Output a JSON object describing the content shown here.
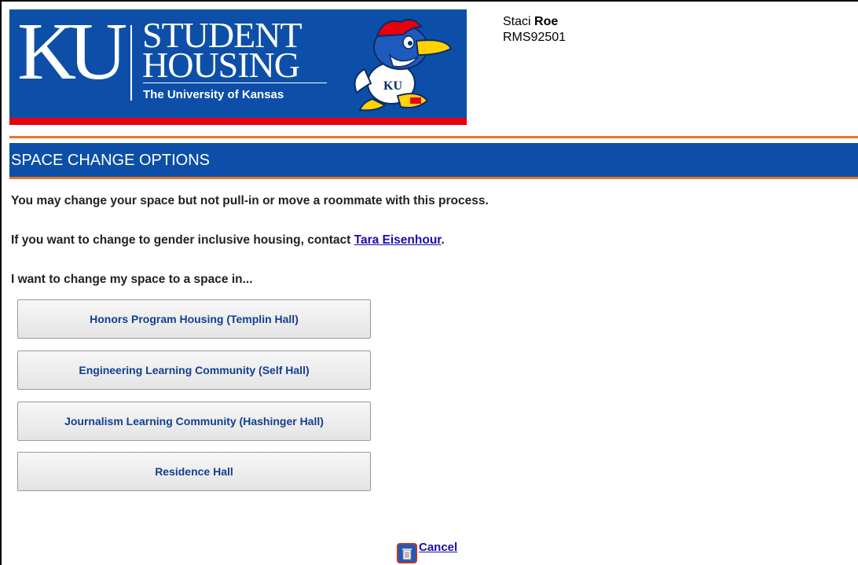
{
  "header": {
    "logo_letters": "KU",
    "title_line1": "STUDENT",
    "title_line2": "HOUSING",
    "university": "The University of Kansas",
    "mascot_icon": "jayhawk-mascot-icon",
    "brand_blue": "#0d4fa8",
    "brand_red": "#e8000d"
  },
  "user": {
    "first_name": "Staci",
    "last_name": "Roe",
    "id": "RMS92501"
  },
  "section": {
    "title": "SPACE CHANGE OPTIONS",
    "accent": "#e87722"
  },
  "messages": {
    "line1": "You may change your space but not pull-in or move a roommate with this process.",
    "line2_prefix": "If you want to change to gender inclusive housing, contact ",
    "line2_link": "Tara Eisenhour",
    "line2_suffix": ".",
    "line3": "I want to change my space to a space in..."
  },
  "options": [
    {
      "label": "Honors Program Housing (Templin Hall)"
    },
    {
      "label": "Engineering Learning Community (Self Hall)"
    },
    {
      "label": "Journalism Learning Community (Hashinger Hall)"
    },
    {
      "label": "Residence Hall"
    }
  ],
  "footer": {
    "cancel_label": "Cancel",
    "cancel_icon": "trash-can-icon"
  }
}
